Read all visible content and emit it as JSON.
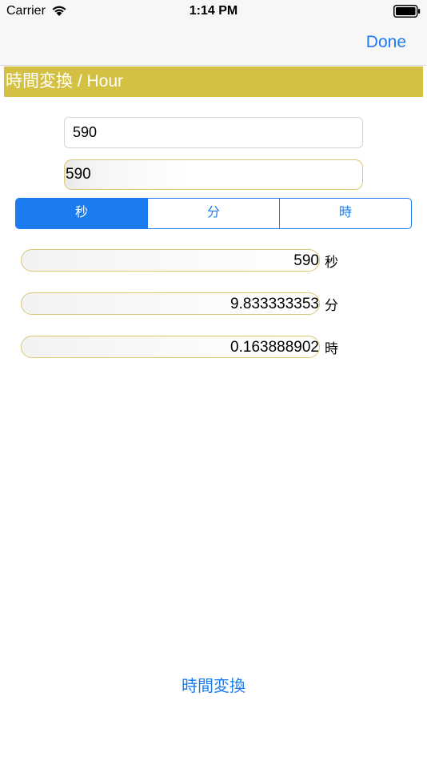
{
  "status_bar": {
    "carrier": "Carrier",
    "time": "1:14 PM",
    "wifi_icon": "wifi-icon",
    "battery_icon": "battery-icon"
  },
  "nav": {
    "done_label": "Done"
  },
  "title": "時間変換 / Hour",
  "input": {
    "value": "590"
  },
  "display": {
    "value": "590"
  },
  "segments": {
    "labels": [
      "秒",
      "分",
      "時"
    ],
    "selected": "秒"
  },
  "results": [
    {
      "value": "590",
      "unit": "秒"
    },
    {
      "value": "9.833333353",
      "unit": "分"
    },
    {
      "value": "0.163888902",
      "unit": "時"
    }
  ],
  "convert_button_label": "時間変換",
  "colors": {
    "accent": "#1a7cf0",
    "banner": "#d4c143",
    "field_border": "#d9c874"
  }
}
